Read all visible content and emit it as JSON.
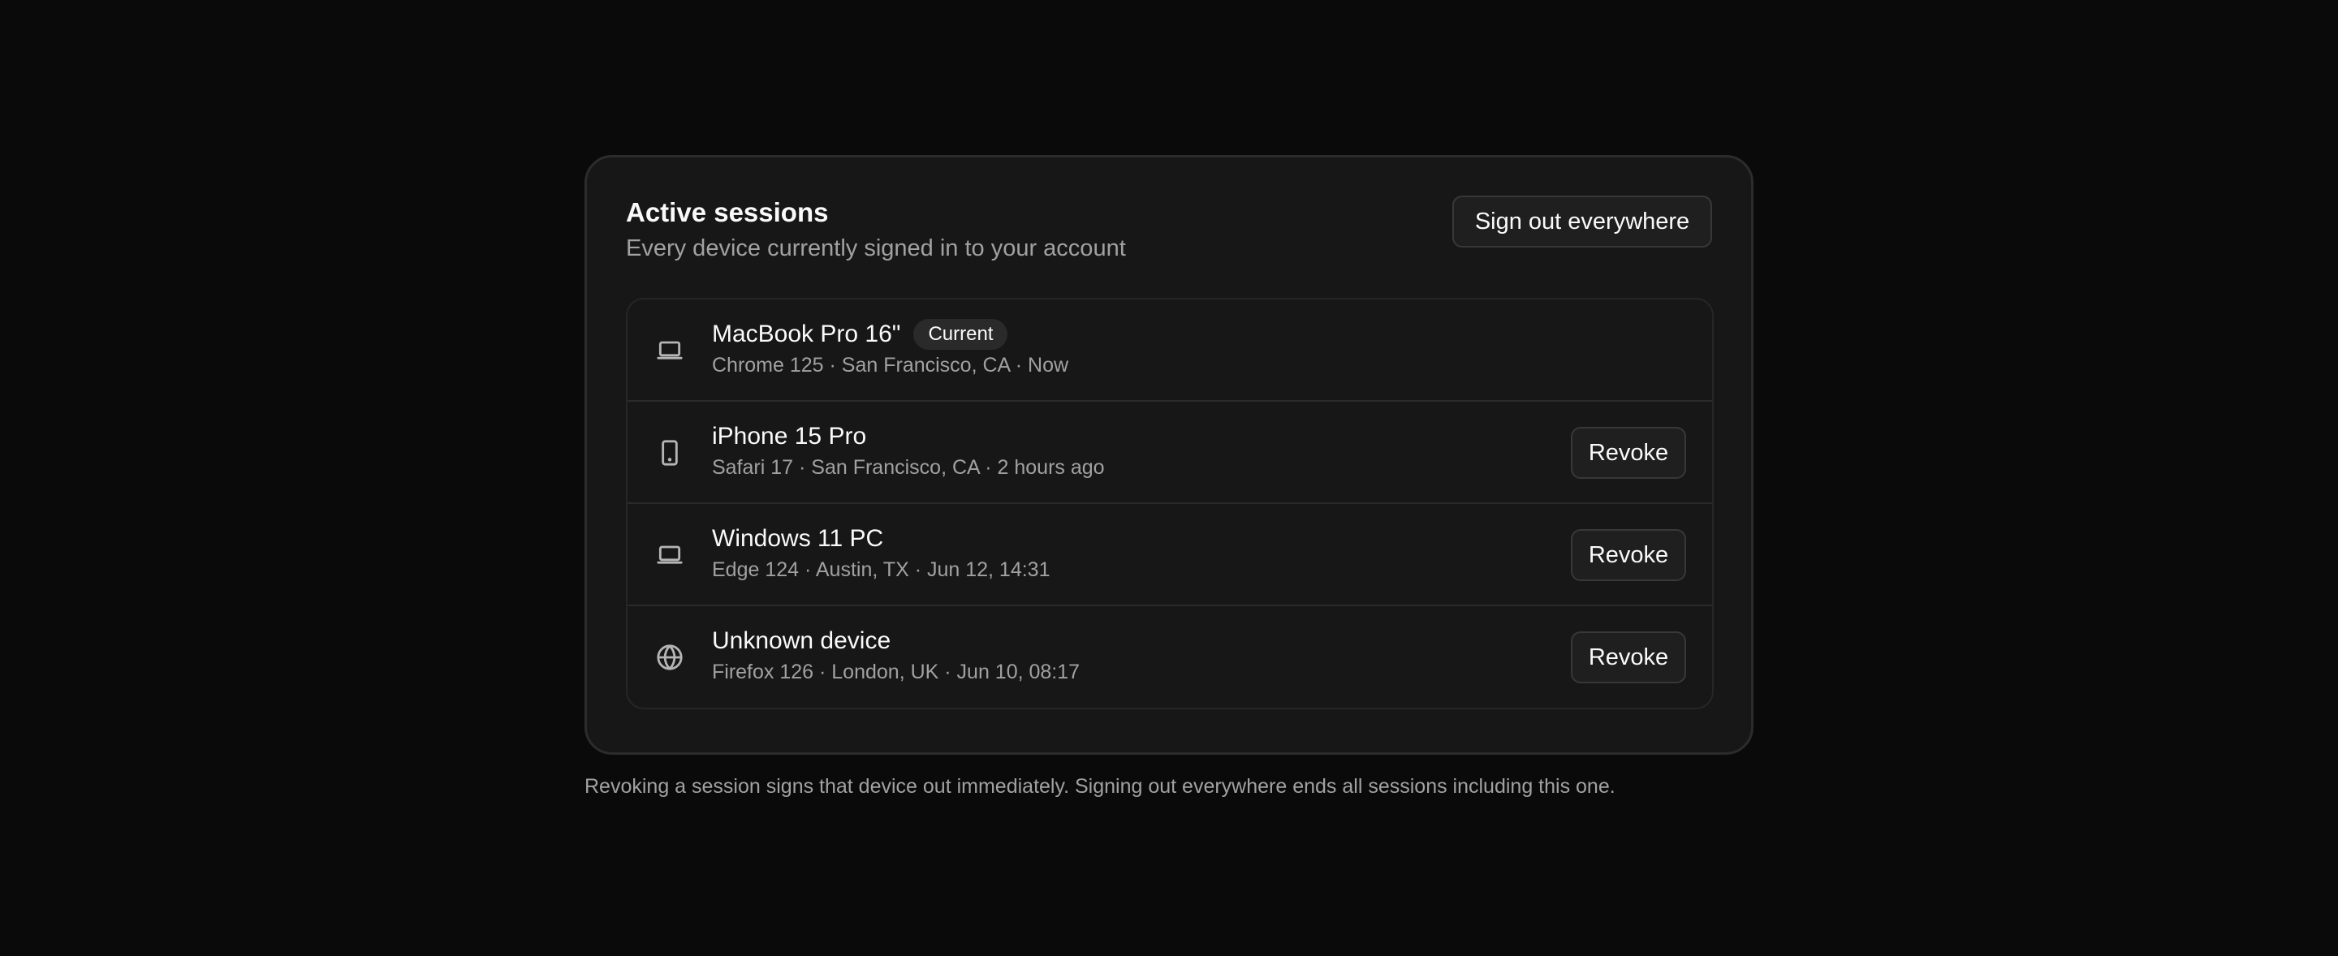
{
  "card": {
    "title": "Active sessions",
    "subtitle": "Every device currently signed in to your account",
    "sign_out_label": "Sign out everywhere"
  },
  "sessions": [
    {
      "icon": "laptop-icon",
      "name": "MacBook Pro 16\"",
      "badge": "Current",
      "meta": "Chrome 125 · San Francisco, CA · Now"
    },
    {
      "icon": "phone-icon",
      "name": "iPhone 15 Pro",
      "meta": "Safari 17 · San Francisco, CA · 2 hours ago",
      "action": "Revoke"
    },
    {
      "icon": "laptop-icon",
      "name": "Windows 11 PC",
      "meta": "Edge 124 · Austin, TX · Jun 12, 14:31",
      "action": "Revoke"
    },
    {
      "icon": "globe-icon",
      "name": "Unknown device",
      "meta": "Firefox 126 · London, UK · Jun 10, 08:17",
      "action": "Revoke"
    }
  ],
  "footnote": "Revoking a session signs that device out immediately. Signing out everywhere ends all sessions including this one.",
  "colors": {
    "background": "#0a0a0a",
    "card": "#171717",
    "text_primary": "#fafafa",
    "text_muted": "#a1a1a1"
  }
}
